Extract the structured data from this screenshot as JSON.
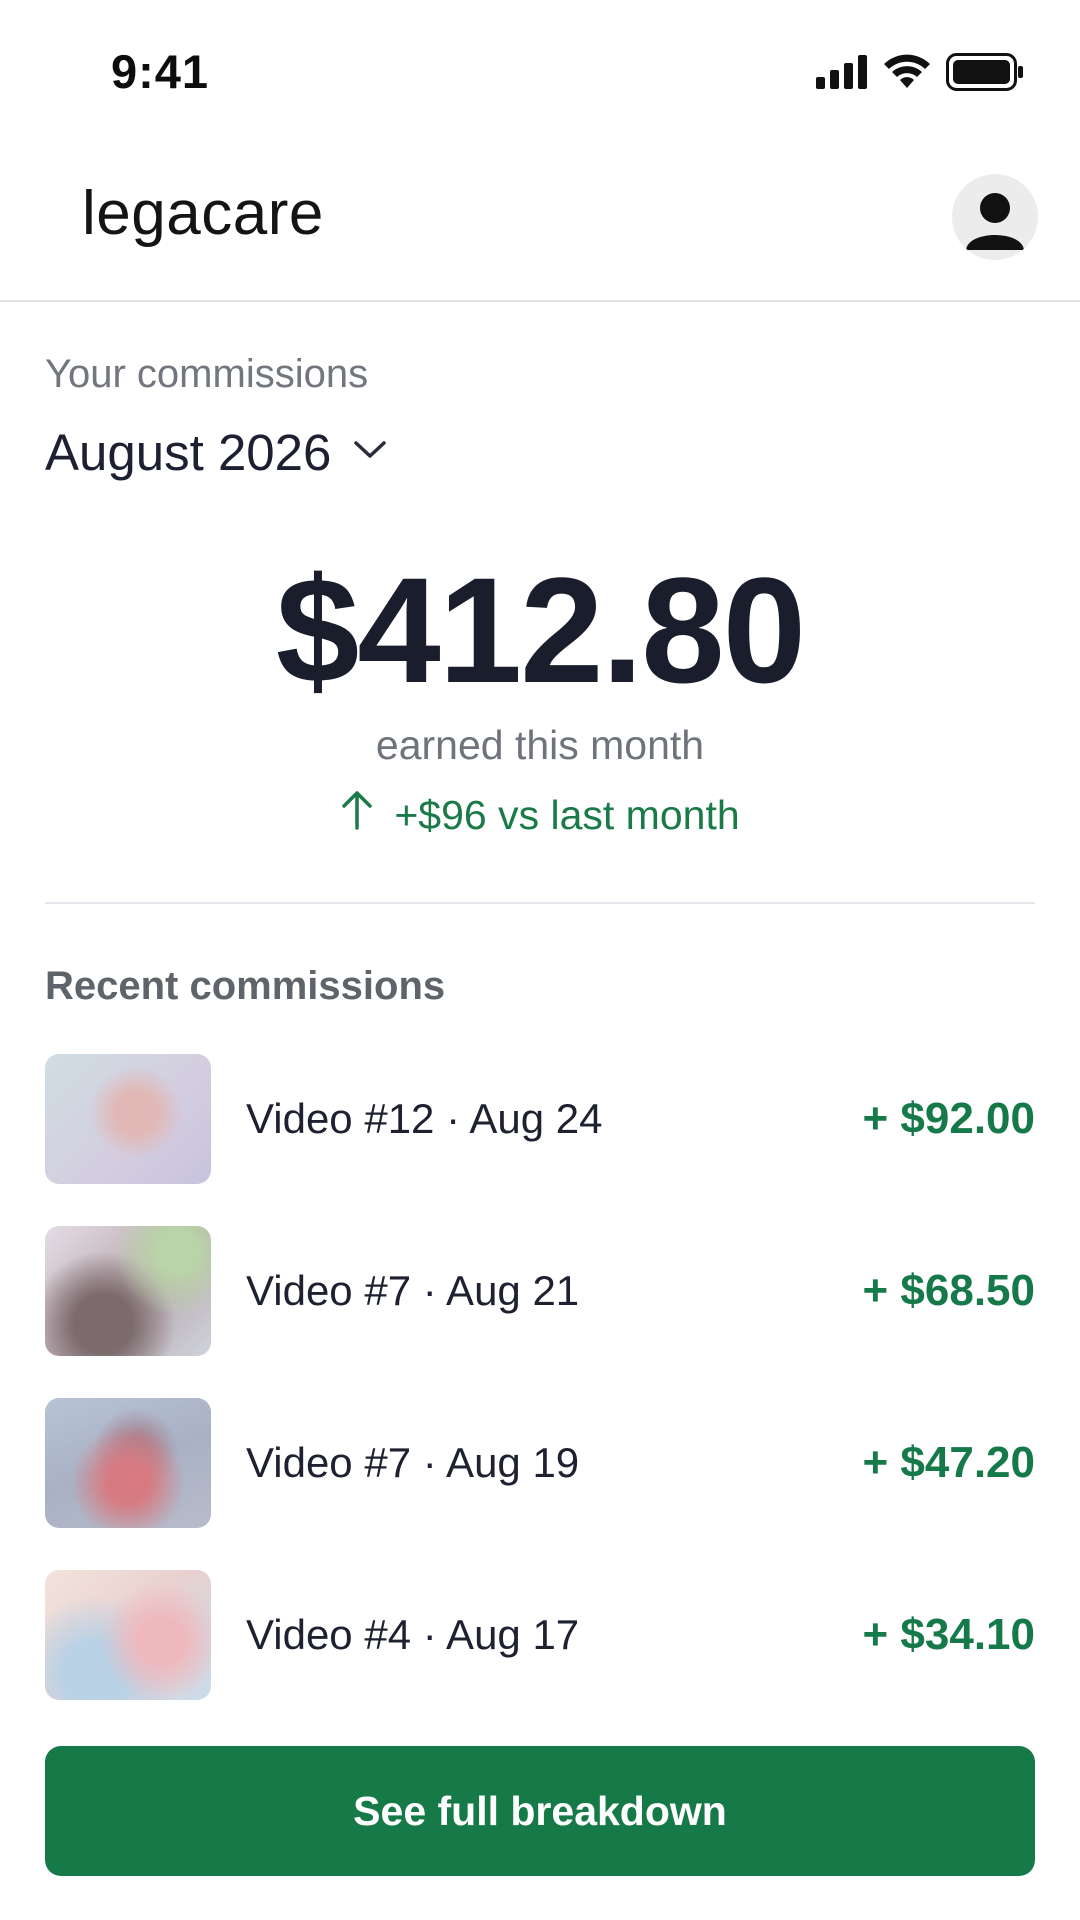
{
  "status_bar": {
    "time": "9:41"
  },
  "header": {
    "brand": "legacare",
    "avatar_icon": "user-avatar-icon"
  },
  "summary": {
    "label": "Your commissions",
    "month": "August 2026",
    "amount": "$412.80",
    "caption": "earned this month",
    "delta": "+$96 vs last month"
  },
  "recent": {
    "title": "Recent commissions",
    "items": [
      {
        "label": "Video #12 · Aug 24",
        "amount": "+ $92.00"
      },
      {
        "label": "Video #7 · Aug 21",
        "amount": "+ $68.50"
      },
      {
        "label": "Video #7 · Aug 19",
        "amount": "+ $47.20"
      },
      {
        "label": "Video #4 · Aug 17",
        "amount": "+ $34.10"
      }
    ]
  },
  "cta": {
    "label": "See full breakdown"
  },
  "colors": {
    "accent": "#167a48",
    "positive": "#1a7a48",
    "text": "#1a1e2c",
    "muted": "#72767d"
  }
}
